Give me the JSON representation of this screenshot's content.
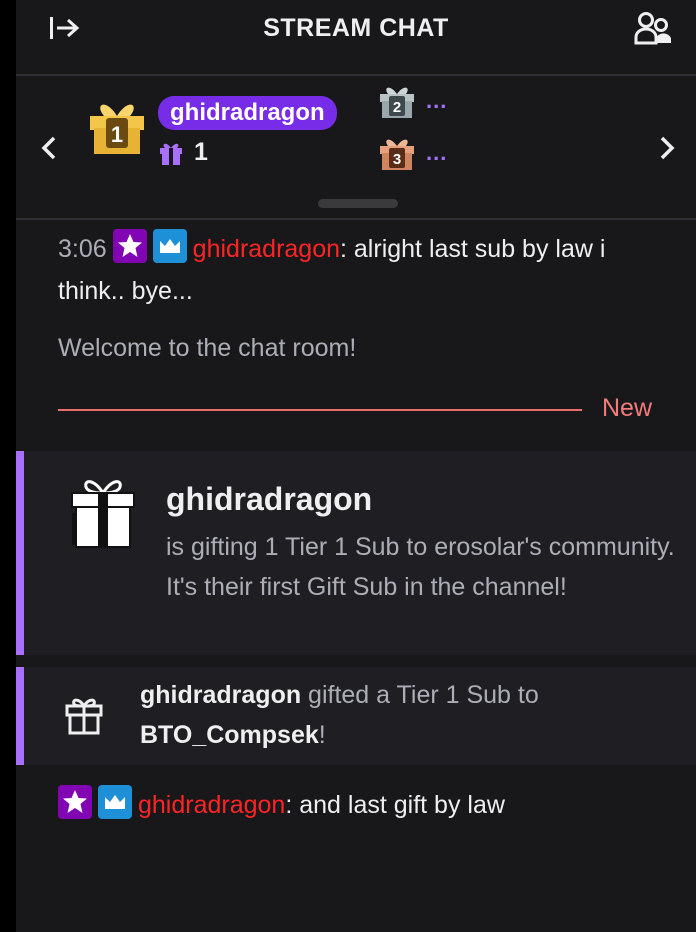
{
  "header": {
    "title": "STREAM CHAT",
    "collapse_icon": "collapse-right-icon",
    "users_icon": "community-icon"
  },
  "leaderboard": {
    "top_user": "ghidradragon",
    "top_count": "1",
    "rank2_more": "...",
    "rank3_more": "...",
    "pill_color": "#772ce8"
  },
  "messages": [
    {
      "time": "3:06",
      "user": "ghidradragon",
      "text": ": alright last sub by law i think.. bye..."
    },
    {
      "user": "ghidradragon",
      "text": ": and last gift by law"
    }
  ],
  "welcome": "Welcome to the chat room!",
  "new_label": "New",
  "gift_announcement": {
    "user": "ghidradragon",
    "text": "is gifting 1 Tier 1 Sub to erosolar's community. It's their first Gift Sub in the channel!"
  },
  "gifted": {
    "user": "ghidradragon",
    "middle": " gifted a Tier 1 Sub to ",
    "recipient": "BTO_Compsek",
    "end": "!"
  },
  "colors": {
    "accent": "#a970ff",
    "username": "#ff2424",
    "divider": "#eb6e6e"
  }
}
